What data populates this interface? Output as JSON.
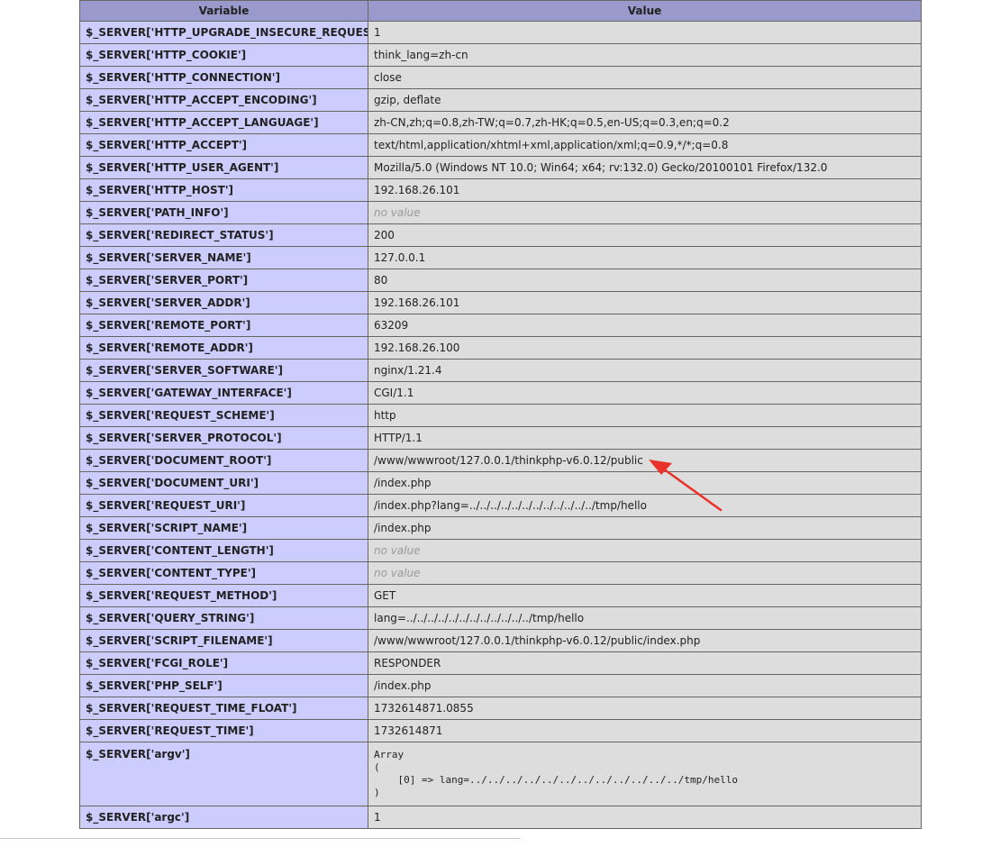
{
  "table": {
    "headers": {
      "variable": "Variable",
      "value": "Value"
    },
    "rows": [
      {
        "name": "$_SERVER['HTTP_UPGRADE_INSECURE_REQUESTS']",
        "value": "1"
      },
      {
        "name": "$_SERVER['HTTP_COOKIE']",
        "value": "think_lang=zh-cn"
      },
      {
        "name": "$_SERVER['HTTP_CONNECTION']",
        "value": "close"
      },
      {
        "name": "$_SERVER['HTTP_ACCEPT_ENCODING']",
        "value": "gzip, deflate"
      },
      {
        "name": "$_SERVER['HTTP_ACCEPT_LANGUAGE']",
        "value": "zh-CN,zh;q=0.8,zh-TW;q=0.7,zh-HK;q=0.5,en-US;q=0.3,en;q=0.2"
      },
      {
        "name": "$_SERVER['HTTP_ACCEPT']",
        "value": "text/html,application/xhtml+xml,application/xml;q=0.9,*/*;q=0.8"
      },
      {
        "name": "$_SERVER['HTTP_USER_AGENT']",
        "value": "Mozilla/5.0 (Windows NT 10.0; Win64; x64; rv:132.0) Gecko/20100101 Firefox/132.0"
      },
      {
        "name": "$_SERVER['HTTP_HOST']",
        "value": "192.168.26.101"
      },
      {
        "name": "$_SERVER['PATH_INFO']",
        "value": "no value",
        "novalue": true
      },
      {
        "name": "$_SERVER['REDIRECT_STATUS']",
        "value": "200"
      },
      {
        "name": "$_SERVER['SERVER_NAME']",
        "value": "127.0.0.1"
      },
      {
        "name": "$_SERVER['SERVER_PORT']",
        "value": "80"
      },
      {
        "name": "$_SERVER['SERVER_ADDR']",
        "value": "192.168.26.101"
      },
      {
        "name": "$_SERVER['REMOTE_PORT']",
        "value": "63209"
      },
      {
        "name": "$_SERVER['REMOTE_ADDR']",
        "value": "192.168.26.100"
      },
      {
        "name": "$_SERVER['SERVER_SOFTWARE']",
        "value": "nginx/1.21.4"
      },
      {
        "name": "$_SERVER['GATEWAY_INTERFACE']",
        "value": "CGI/1.1"
      },
      {
        "name": "$_SERVER['REQUEST_SCHEME']",
        "value": "http"
      },
      {
        "name": "$_SERVER['SERVER_PROTOCOL']",
        "value": "HTTP/1.1"
      },
      {
        "name": "$_SERVER['DOCUMENT_ROOT']",
        "value": "/www/wwwroot/127.0.0.1/thinkphp-v6.0.12/public"
      },
      {
        "name": "$_SERVER['DOCUMENT_URI']",
        "value": "/index.php"
      },
      {
        "name": "$_SERVER['REQUEST_URI']",
        "value": "/index.php?lang=../../../../../../../../../../../../tmp/hello"
      },
      {
        "name": "$_SERVER['SCRIPT_NAME']",
        "value": "/index.php"
      },
      {
        "name": "$_SERVER['CONTENT_LENGTH']",
        "value": "no value",
        "novalue": true
      },
      {
        "name": "$_SERVER['CONTENT_TYPE']",
        "value": "no value",
        "novalue": true
      },
      {
        "name": "$_SERVER['REQUEST_METHOD']",
        "value": "GET"
      },
      {
        "name": "$_SERVER['QUERY_STRING']",
        "value": "lang=../../../../../../../../../../../../tmp/hello"
      },
      {
        "name": "$_SERVER['SCRIPT_FILENAME']",
        "value": "/www/wwwroot/127.0.0.1/thinkphp-v6.0.12/public/index.php"
      },
      {
        "name": "$_SERVER['FCGI_ROLE']",
        "value": "RESPONDER"
      },
      {
        "name": "$_SERVER['PHP_SELF']",
        "value": "/index.php"
      },
      {
        "name": "$_SERVER['REQUEST_TIME_FLOAT']",
        "value": "1732614871.0855"
      },
      {
        "name": "$_SERVER['REQUEST_TIME']",
        "value": "1732614871"
      },
      {
        "name": "$_SERVER['argv']",
        "value": "Array\n(\n    [0] => lang=../../../../../../../../../../../../tmp/hello\n)",
        "pre": true
      },
      {
        "name": "$_SERVER['argc']",
        "value": "1"
      }
    ]
  },
  "annotation": {
    "type": "red-arrow-icon",
    "color": "#e8322a"
  },
  "colors": {
    "header_bg": "#9999cc",
    "name_bg": "#ccccff",
    "value_bg": "#dddddd",
    "border": "#666666"
  }
}
